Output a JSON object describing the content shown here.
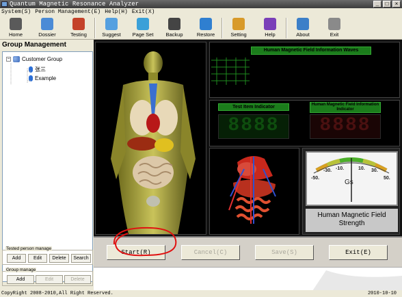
{
  "window": {
    "title": "Quantum Magnetic Resonance Analyzer"
  },
  "menu": [
    "System(S)",
    "Person Management(E)",
    "Help(H)",
    "Exit(X)"
  ],
  "toolbar": [
    {
      "label": "Home",
      "icon": "home-icon",
      "color": "#5a5a5a"
    },
    {
      "label": "Dossier",
      "icon": "dossier-icon",
      "color": "#4b8bd6"
    },
    {
      "label": "Testing",
      "icon": "testing-icon",
      "color": "#c4422a"
    },
    {
      "label": "Suggest",
      "icon": "suggest-icon",
      "color": "#55a0e0"
    },
    {
      "label": "Page Set",
      "icon": "page-set-icon",
      "color": "#3aa0d8"
    },
    {
      "label": "Backup",
      "icon": "backup-icon",
      "color": "#444444"
    },
    {
      "label": "Restore",
      "icon": "restore-icon",
      "color": "#2f7fd0"
    },
    {
      "label": "Setting",
      "icon": "setting-icon",
      "color": "#d89a2a"
    },
    {
      "label": "Help",
      "icon": "help-icon",
      "color": "#7a3fb8"
    },
    {
      "label": "About",
      "icon": "about-icon",
      "color": "#3c7fc8"
    },
    {
      "label": "Exit",
      "icon": "exit-icon",
      "color": "#8a8a8a"
    }
  ],
  "sidebar": {
    "title": "Group Management",
    "tree": {
      "group": "Customer Group",
      "people": [
        "张三",
        "Example"
      ]
    },
    "tested_person": {
      "label": "Tested person manage",
      "buttons": [
        "Add",
        "Edit",
        "Delete",
        "Search"
      ]
    },
    "group_manage": {
      "label": "Group manage",
      "buttons": [
        "Add",
        "Edit",
        "Delete"
      ]
    }
  },
  "panels": {
    "waves_title": "Human Magnetic Field Information Waves",
    "test_item_title": "Test Item Indicator",
    "info_indicator_title": "Human Magnetic Field Information Indicator",
    "test_item_value": "8888",
    "info_indicator_value": "8888",
    "gauge": {
      "unit": "Gs",
      "ticks": [
        "-50.",
        "-30.",
        "-10.",
        "10.",
        "30.",
        "50."
      ],
      "value": 0,
      "label": "Human Magnetic Field Strength"
    }
  },
  "actions": {
    "start": "Start(R)",
    "cancel": "Cancel(C)",
    "save": "Save(S)",
    "exit": "Exit(E)"
  },
  "status": {
    "copyright": "CopyRight 2008-2010,All Right Reserved.",
    "date": "2010-10-10"
  }
}
